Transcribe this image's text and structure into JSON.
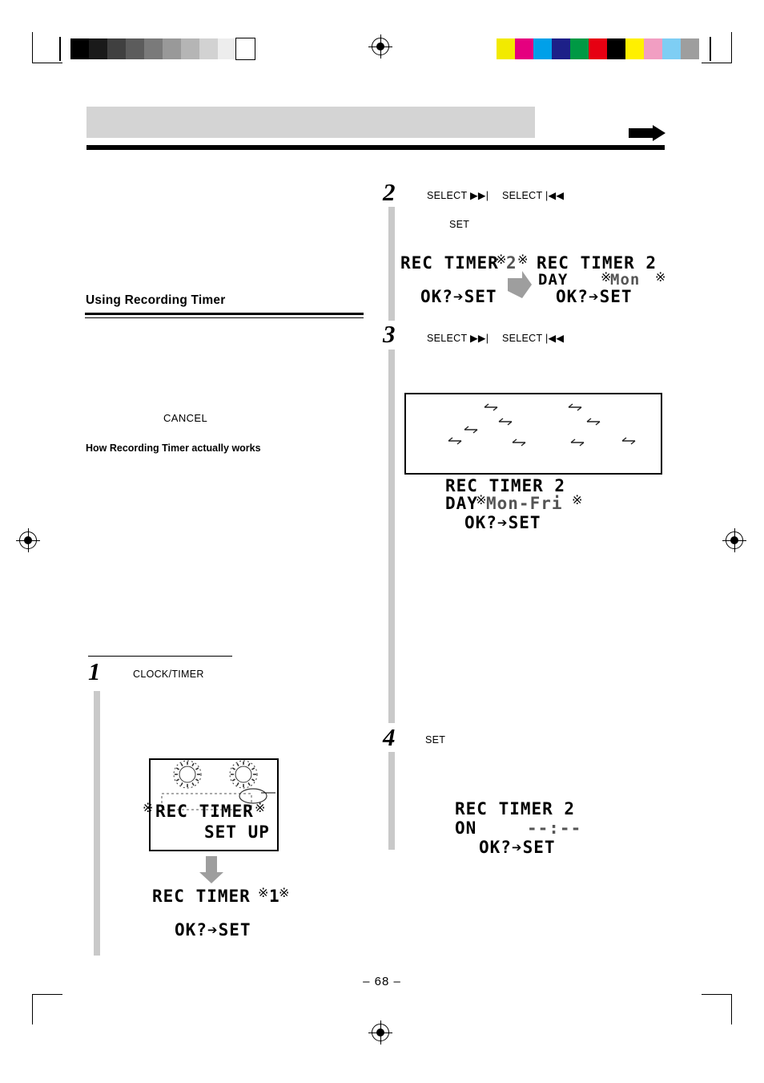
{
  "document": {
    "page_number": "– 68 –",
    "section_heading": "Using Recording Timer",
    "cancel_label": "CANCEL",
    "howto_heading": "How Recording Timer actually works"
  },
  "steps": [
    {
      "number": "1",
      "controls": [
        "CLOCK/TIMER"
      ],
      "display_lines": [
        "REC TIMER",
        "SET UP"
      ],
      "display2_lines": [
        "REC TIMER 1",
        "OK?→SET"
      ]
    },
    {
      "number": "2",
      "controls": [
        "SELECT ▶▶|",
        "SELECT |◀◀",
        "SET"
      ],
      "display_left_lines": [
        "REC TIMER 2",
        "OK?→SET"
      ],
      "display_right_lines": [
        "REC TIMER 2",
        "DAY  Mon",
        "OK?→SET"
      ]
    },
    {
      "number": "3",
      "controls": [
        "SELECT ▶▶|",
        "SELECT |◀◀"
      ],
      "display_lines": [
        "REC TIMER 2",
        "DAY Mon-Fri",
        "OK?→SET"
      ]
    },
    {
      "number": "4",
      "controls": [
        "SET"
      ],
      "display_lines": [
        "REC TIMER 2",
        "ON    --:--",
        "OK?→SET"
      ]
    }
  ],
  "lcd_text": {
    "rec_timer": "REC TIMER",
    "rec_timer_2": "REC TIMER 2",
    "set_up": "SET UP",
    "ok_set": "OK?➔SET",
    "day": "DAY",
    "mon": "Mon",
    "mon_fri": "Mon-Fri",
    "on": "ON",
    "time_blank": "--:--",
    "one": "1",
    "two": "2"
  },
  "calibration": {
    "gray_swatches": [
      "#000000",
      "#1a1a1a",
      "#404040",
      "#5c5c5c",
      "#7a7a7a",
      "#999999",
      "#b5b5b5",
      "#d2d2d2",
      "#ededed",
      "#ffffff"
    ],
    "color_swatches": [
      "#f2ea00",
      "#e5007f",
      "#00a0e9",
      "#1d2088",
      "#009944",
      "#e60012",
      "#000000",
      "#fff000",
      "#f19ec2",
      "#7ecef4",
      "#9e9e9e"
    ]
  }
}
